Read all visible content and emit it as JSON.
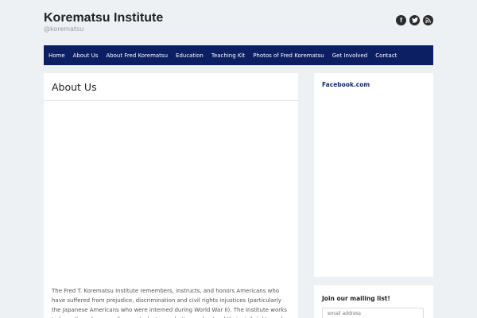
{
  "site": {
    "title": "Korematsu Institute",
    "tagline": "@korematsu"
  },
  "social": [
    {
      "icon": "facebook-icon",
      "glyph": "f"
    },
    {
      "icon": "twitter-icon",
      "glyph": "bird"
    },
    {
      "icon": "rss-icon",
      "glyph": "rss"
    }
  ],
  "nav": {
    "items": [
      "Home",
      "About Us",
      "About Fred Korematsu",
      "Education",
      "Teaching Kit",
      "Photos of Fred Korematsu",
      "Get Involved",
      "Contact"
    ]
  },
  "main": {
    "title": "About Us",
    "body": "The Fred T. Korematsu Institute remembers, instructs, and honors Americans who have suffered from prejudice, discrimination and civil rights injustices (particularly the Japanese Americans who were interned during World War II). The Institute works to keep these lessons alive so students can better understand their civil rights and civil"
  },
  "sidebar": {
    "facebook_title": "Facebook.com",
    "mailing_title": "Join our mailing list!",
    "email_placeholder": "email address"
  },
  "colors": {
    "nav_background": "#0c1f62",
    "page_background": "#eef1f4",
    "facebook_title": "#0c2a6b"
  }
}
